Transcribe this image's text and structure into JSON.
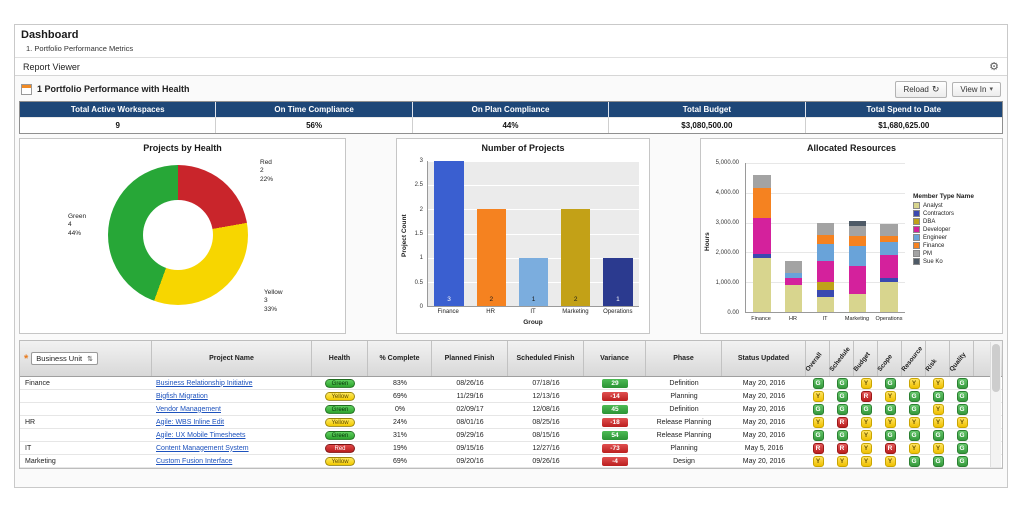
{
  "icons": {
    "gear": "⚙",
    "reload": "↻",
    "dropdown": "▾",
    "filter": "*",
    "spinner": "⇅"
  },
  "page": {
    "title": "Dashboard",
    "breadcrumb": "1. Portfolio Performance Metrics",
    "section_title": "Report Viewer"
  },
  "report": {
    "title": "1 Portfolio Performance with Health",
    "reload_label": "Reload",
    "view_in_label": "View In"
  },
  "kpis": [
    {
      "label": "Total Active Workspaces",
      "value": "9"
    },
    {
      "label": "On Time Compliance",
      "value": "56%"
    },
    {
      "label": "On Plan Compliance",
      "value": "44%"
    },
    {
      "label": "Total Budget",
      "value": "$3,080,500.00"
    },
    {
      "label": "Total Spend to Date",
      "value": "$1,680,625.00"
    }
  ],
  "chart_data": [
    {
      "type": "pie",
      "title": "Projects by Health",
      "donut": true,
      "slices": [
        {
          "name": "Red",
          "count": "2",
          "percent": "22%",
          "value": 22,
          "color": "#c9252b"
        },
        {
          "name": "Yellow",
          "count": "3",
          "percent": "33%",
          "value": 33,
          "color": "#f7d600"
        },
        {
          "name": "Green",
          "count": "4",
          "percent": "44%",
          "value": 44,
          "color": "#27a737"
        }
      ]
    },
    {
      "type": "bar",
      "title": "Number of Projects",
      "xlabel": "Group",
      "ylabel": "Project Count",
      "ylim": [
        0,
        3
      ],
      "yticks": [
        0,
        0.5,
        1,
        1.5,
        2,
        2.5,
        3
      ],
      "categories": [
        "Finance",
        "HR",
        "IT",
        "Marketing",
        "Operations"
      ],
      "values": [
        3,
        2,
        1,
        2,
        1
      ],
      "colors": [
        "#3a5fd0",
        "#f58220",
        "#7badde",
        "#c3a117",
        "#2b3a8f"
      ]
    },
    {
      "type": "stacked-bar",
      "title": "Allocated Resources",
      "ylabel": "Hours",
      "ylim": [
        0,
        5000
      ],
      "ytick_labels": [
        "0.00",
        "1,000.00",
        "2,000.00",
        "3,000.00",
        "4,000.00",
        "5,000.00"
      ],
      "categories": [
        "Finance",
        "HR",
        "IT",
        "Marketing",
        "Operations"
      ],
      "legend_title": "Member Type Name",
      "series": [
        {
          "name": "Analyst",
          "color": "#d8d58e",
          "values": [
            1800,
            900,
            500,
            600,
            1000
          ]
        },
        {
          "name": "Contractors",
          "color": "#3a49b0",
          "values": [
            150,
            0,
            250,
            0,
            150
          ]
        },
        {
          "name": "DBA",
          "color": "#bfa21a",
          "values": [
            0,
            0,
            250,
            0,
            0
          ]
        },
        {
          "name": "Developer",
          "color": "#d4219c",
          "values": [
            1200,
            250,
            700,
            950,
            750
          ]
        },
        {
          "name": "Engineer",
          "color": "#69a3d9",
          "values": [
            0,
            150,
            600,
            650,
            450
          ]
        },
        {
          "name": "Finance",
          "color": "#f58220",
          "values": [
            1000,
            0,
            300,
            350,
            200
          ]
        },
        {
          "name": "PM",
          "color": "#a3a3a3",
          "values": [
            450,
            400,
            400,
            350,
            400
          ]
        },
        {
          "name": "Sue Ko",
          "color": "#4e5a66",
          "values": [
            0,
            0,
            0,
            150,
            0
          ]
        }
      ]
    }
  ],
  "table": {
    "filter_label": "Business Unit",
    "columns": [
      "Project Name",
      "Health",
      "% Complete",
      "Planned Finish",
      "Scheduled Finish",
      "Variance",
      "Phase",
      "Status Updated"
    ],
    "rotated_columns": [
      "Overall",
      "Schedule",
      "Budget",
      "Scope",
      "Resource",
      "Risk",
      "Quality"
    ],
    "rows": [
      {
        "group": "Finance",
        "project": "Business Relationship Initiative",
        "health": "Green",
        "complete": "83%",
        "planned": "08/26/16",
        "scheduled": "07/18/16",
        "variance": "29",
        "phase": "Definition",
        "updated": "May 20, 2016",
        "badges": [
          "G",
          "G",
          "Y",
          "G",
          "Y",
          "Y",
          "G"
        ]
      },
      {
        "group": "",
        "project": "Bigfish Migration",
        "health": "Yellow",
        "complete": "69%",
        "planned": "11/29/16",
        "scheduled": "12/13/16",
        "variance": "-14",
        "phase": "Planning",
        "updated": "May 20, 2016",
        "badges": [
          "Y",
          "G",
          "R",
          "Y",
          "G",
          "G",
          "G"
        ]
      },
      {
        "group": "",
        "project": "Vendor Management",
        "health": "Green",
        "complete": "0%",
        "planned": "02/09/17",
        "scheduled": "12/08/16",
        "variance": "45",
        "phase": "Definition",
        "updated": "May 20, 2016",
        "badges": [
          "G",
          "G",
          "G",
          "G",
          "G",
          "Y",
          "G"
        ]
      },
      {
        "group": "HR",
        "project": "Agile: WBS Inline Edit",
        "health": "Yellow",
        "complete": "24%",
        "planned": "08/01/16",
        "scheduled": "08/25/16",
        "variance": "-18",
        "phase": "Release Planning",
        "updated": "May 20, 2016",
        "badges": [
          "Y",
          "R",
          "Y",
          "Y",
          "Y",
          "Y",
          "Y"
        ]
      },
      {
        "group": "",
        "project": "Agile: UX Mobile Timesheets",
        "health": "Green",
        "complete": "31%",
        "planned": "09/29/16",
        "scheduled": "08/15/16",
        "variance": "54",
        "phase": "Release Planning",
        "updated": "May 20, 2016",
        "badges": [
          "G",
          "G",
          "Y",
          "G",
          "G",
          "G",
          "G"
        ]
      },
      {
        "group": "IT",
        "project": "Content Management System",
        "health": "Red",
        "complete": "19%",
        "planned": "09/15/16",
        "scheduled": "12/27/16",
        "variance": "-73",
        "phase": "Planning",
        "updated": "May 5, 2016",
        "badges": [
          "R",
          "R",
          "Y",
          "R",
          "Y",
          "Y",
          "G"
        ]
      },
      {
        "group": "Marketing",
        "project": "Custom Fusion Interface",
        "health": "Yellow",
        "complete": "69%",
        "planned": "09/20/16",
        "scheduled": "09/26/16",
        "variance": "-4",
        "phase": "Design",
        "updated": "May 20, 2016",
        "badges": [
          "Y",
          "Y",
          "Y",
          "Y",
          "G",
          "G",
          "G"
        ]
      }
    ]
  }
}
